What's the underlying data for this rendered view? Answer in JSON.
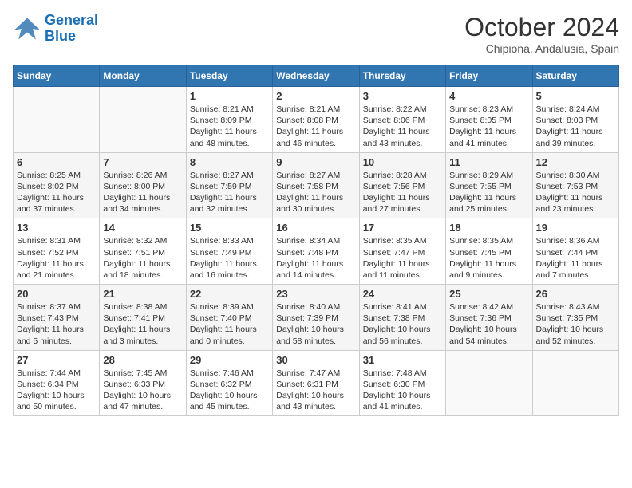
{
  "logo": {
    "line1": "General",
    "line2": "Blue"
  },
  "title": "October 2024",
  "subtitle": "Chipiona, Andalusia, Spain",
  "days_of_week": [
    "Sunday",
    "Monday",
    "Tuesday",
    "Wednesday",
    "Thursday",
    "Friday",
    "Saturday"
  ],
  "weeks": [
    [
      {
        "day": "",
        "info": ""
      },
      {
        "day": "",
        "info": ""
      },
      {
        "day": "1",
        "info": "Sunrise: 8:21 AM\nSunset: 8:09 PM\nDaylight: 11 hours and 48 minutes."
      },
      {
        "day": "2",
        "info": "Sunrise: 8:21 AM\nSunset: 8:08 PM\nDaylight: 11 hours and 46 minutes."
      },
      {
        "day": "3",
        "info": "Sunrise: 8:22 AM\nSunset: 8:06 PM\nDaylight: 11 hours and 43 minutes."
      },
      {
        "day": "4",
        "info": "Sunrise: 8:23 AM\nSunset: 8:05 PM\nDaylight: 11 hours and 41 minutes."
      },
      {
        "day": "5",
        "info": "Sunrise: 8:24 AM\nSunset: 8:03 PM\nDaylight: 11 hours and 39 minutes."
      }
    ],
    [
      {
        "day": "6",
        "info": "Sunrise: 8:25 AM\nSunset: 8:02 PM\nDaylight: 11 hours and 37 minutes."
      },
      {
        "day": "7",
        "info": "Sunrise: 8:26 AM\nSunset: 8:00 PM\nDaylight: 11 hours and 34 minutes."
      },
      {
        "day": "8",
        "info": "Sunrise: 8:27 AM\nSunset: 7:59 PM\nDaylight: 11 hours and 32 minutes."
      },
      {
        "day": "9",
        "info": "Sunrise: 8:27 AM\nSunset: 7:58 PM\nDaylight: 11 hours and 30 minutes."
      },
      {
        "day": "10",
        "info": "Sunrise: 8:28 AM\nSunset: 7:56 PM\nDaylight: 11 hours and 27 minutes."
      },
      {
        "day": "11",
        "info": "Sunrise: 8:29 AM\nSunset: 7:55 PM\nDaylight: 11 hours and 25 minutes."
      },
      {
        "day": "12",
        "info": "Sunrise: 8:30 AM\nSunset: 7:53 PM\nDaylight: 11 hours and 23 minutes."
      }
    ],
    [
      {
        "day": "13",
        "info": "Sunrise: 8:31 AM\nSunset: 7:52 PM\nDaylight: 11 hours and 21 minutes."
      },
      {
        "day": "14",
        "info": "Sunrise: 8:32 AM\nSunset: 7:51 PM\nDaylight: 11 hours and 18 minutes."
      },
      {
        "day": "15",
        "info": "Sunrise: 8:33 AM\nSunset: 7:49 PM\nDaylight: 11 hours and 16 minutes."
      },
      {
        "day": "16",
        "info": "Sunrise: 8:34 AM\nSunset: 7:48 PM\nDaylight: 11 hours and 14 minutes."
      },
      {
        "day": "17",
        "info": "Sunrise: 8:35 AM\nSunset: 7:47 PM\nDaylight: 11 hours and 11 minutes."
      },
      {
        "day": "18",
        "info": "Sunrise: 8:35 AM\nSunset: 7:45 PM\nDaylight: 11 hours and 9 minutes."
      },
      {
        "day": "19",
        "info": "Sunrise: 8:36 AM\nSunset: 7:44 PM\nDaylight: 11 hours and 7 minutes."
      }
    ],
    [
      {
        "day": "20",
        "info": "Sunrise: 8:37 AM\nSunset: 7:43 PM\nDaylight: 11 hours and 5 minutes."
      },
      {
        "day": "21",
        "info": "Sunrise: 8:38 AM\nSunset: 7:41 PM\nDaylight: 11 hours and 3 minutes."
      },
      {
        "day": "22",
        "info": "Sunrise: 8:39 AM\nSunset: 7:40 PM\nDaylight: 11 hours and 0 minutes."
      },
      {
        "day": "23",
        "info": "Sunrise: 8:40 AM\nSunset: 7:39 PM\nDaylight: 10 hours and 58 minutes."
      },
      {
        "day": "24",
        "info": "Sunrise: 8:41 AM\nSunset: 7:38 PM\nDaylight: 10 hours and 56 minutes."
      },
      {
        "day": "25",
        "info": "Sunrise: 8:42 AM\nSunset: 7:36 PM\nDaylight: 10 hours and 54 minutes."
      },
      {
        "day": "26",
        "info": "Sunrise: 8:43 AM\nSunset: 7:35 PM\nDaylight: 10 hours and 52 minutes."
      }
    ],
    [
      {
        "day": "27",
        "info": "Sunrise: 7:44 AM\nSunset: 6:34 PM\nDaylight: 10 hours and 50 minutes."
      },
      {
        "day": "28",
        "info": "Sunrise: 7:45 AM\nSunset: 6:33 PM\nDaylight: 10 hours and 47 minutes."
      },
      {
        "day": "29",
        "info": "Sunrise: 7:46 AM\nSunset: 6:32 PM\nDaylight: 10 hours and 45 minutes."
      },
      {
        "day": "30",
        "info": "Sunrise: 7:47 AM\nSunset: 6:31 PM\nDaylight: 10 hours and 43 minutes."
      },
      {
        "day": "31",
        "info": "Sunrise: 7:48 AM\nSunset: 6:30 PM\nDaylight: 10 hours and 41 minutes."
      },
      {
        "day": "",
        "info": ""
      },
      {
        "day": "",
        "info": ""
      }
    ]
  ]
}
